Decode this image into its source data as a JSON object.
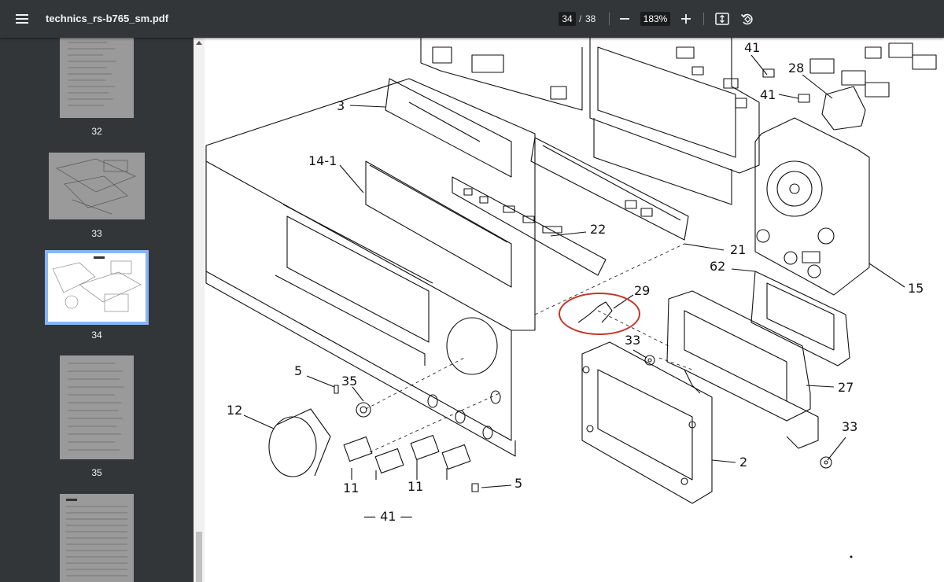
{
  "toolbar": {
    "title": "technics_rs-b765_sm.pdf",
    "current_page": "34",
    "page_separator": "/",
    "total_pages": "38",
    "zoom": "183%"
  },
  "sidebar": {
    "thumbnails": [
      {
        "label": "32"
      },
      {
        "label": "33"
      },
      {
        "label": "34",
        "selected": true
      },
      {
        "label": "35"
      },
      {
        "label": ""
      }
    ]
  },
  "diagram": {
    "callouts": [
      "3",
      "14-1",
      "22",
      "21",
      "41",
      "41",
      "28",
      "15",
      "62",
      "29",
      "33",
      "27",
      "33",
      "2",
      "5",
      "35",
      "12",
      "11",
      "11",
      "5"
    ],
    "page_number": "— 41 —"
  },
  "colors": {
    "toolbar_bg": "#323639",
    "sidebar_bg": "#323639",
    "selected_thumb_border": "#8ab4f8",
    "annotation_circle": "#c0392b"
  }
}
